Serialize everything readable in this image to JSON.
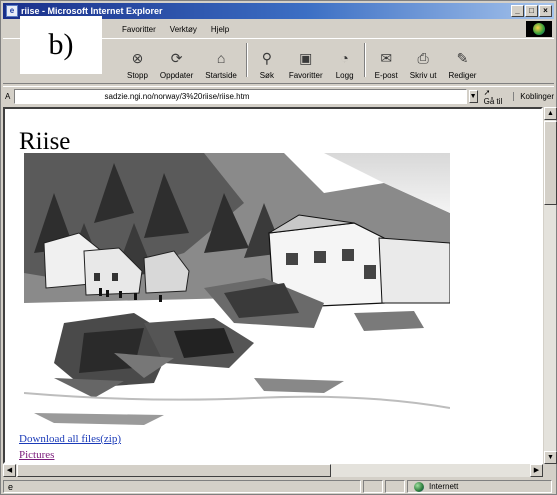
{
  "window": {
    "title": "riise - Microsoft Internet Explorer",
    "minimize": "_",
    "maximize": "□",
    "close": "×"
  },
  "menu": [
    {
      "label": "Favoritter"
    },
    {
      "label": "Verktøy"
    },
    {
      "label": "Hjelp"
    }
  ],
  "toolbar": [
    {
      "label": "Stopp",
      "icon": "stop-icon",
      "glyph": "⊗"
    },
    {
      "label": "Oppdater",
      "icon": "refresh-icon",
      "glyph": "⟳"
    },
    {
      "label": "Startside",
      "icon": "home-icon",
      "glyph": "⌂"
    },
    {
      "label": "Søk",
      "icon": "search-icon",
      "glyph": "⚲"
    },
    {
      "label": "Favoritter",
      "icon": "favorites-icon",
      "glyph": "▣"
    },
    {
      "label": "Logg",
      "icon": "history-icon",
      "glyph": "◔"
    },
    {
      "label": "E-post",
      "icon": "mail-icon",
      "glyph": "✉"
    },
    {
      "label": "Skriv ut",
      "icon": "print-icon",
      "glyph": "⎙"
    },
    {
      "label": "Rediger",
      "icon": "edit-icon",
      "glyph": "✎"
    }
  ],
  "address": {
    "label": "A",
    "url": "sadzie.ngi.no/norway/3%20riise/riise.htm",
    "go_label": "Gå til",
    "links_label": "Koblinger"
  },
  "page": {
    "title": "Riise",
    "photo_icon": "avalanche-damage-photo",
    "links": [
      {
        "label": "Download all files(zip)"
      },
      {
        "label": "Pictures"
      }
    ]
  },
  "status": {
    "zone": "Internett"
  },
  "panel_label": "b)"
}
